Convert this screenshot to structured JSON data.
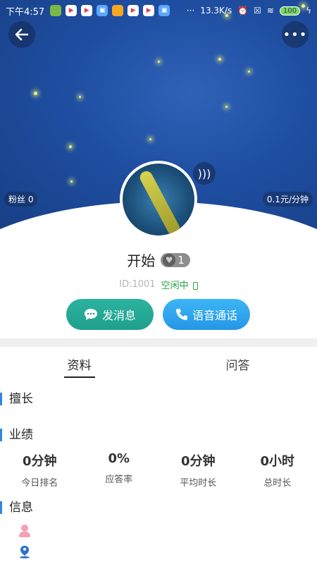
{
  "status_bar": {
    "time": "下午4:57",
    "net_speed": "13.3K/s",
    "battery": "100"
  },
  "profile": {
    "fans_label": "粉丝 0",
    "price_label": "0.1元/分钟",
    "name": "开始",
    "likes": "1",
    "id_label": "ID:1001",
    "status": "空闲中"
  },
  "actions": {
    "message_label": "发消息",
    "voice_call_label": "语音通话"
  },
  "tabs": [
    {
      "label": "资料",
      "active": true
    },
    {
      "label": "问答",
      "active": false
    }
  ],
  "sections": {
    "skill": "擅长",
    "performance": "业绩",
    "info": "信息"
  },
  "stats": [
    {
      "value": "0分钟",
      "label": "今日排名"
    },
    {
      "value": "0%",
      "label": "应答率"
    },
    {
      "value": "0分钟",
      "label": "平均时长"
    },
    {
      "value": "0小时",
      "label": "总时长"
    }
  ],
  "colors": {
    "cover_blue": "#1f4ea1",
    "message_green": "#1f9f8c",
    "call_blue": "#2696e6",
    "accent_blue": "#2f86e0",
    "online_green": "#2aa34a"
  },
  "icons": {
    "back": "arrow-left-icon",
    "more": "more-dots-icon",
    "sound": "sound-wave-icon",
    "message": "chat-bubble-icon",
    "call": "phone-icon",
    "person": "person-icon",
    "location": "location-pin-icon"
  }
}
